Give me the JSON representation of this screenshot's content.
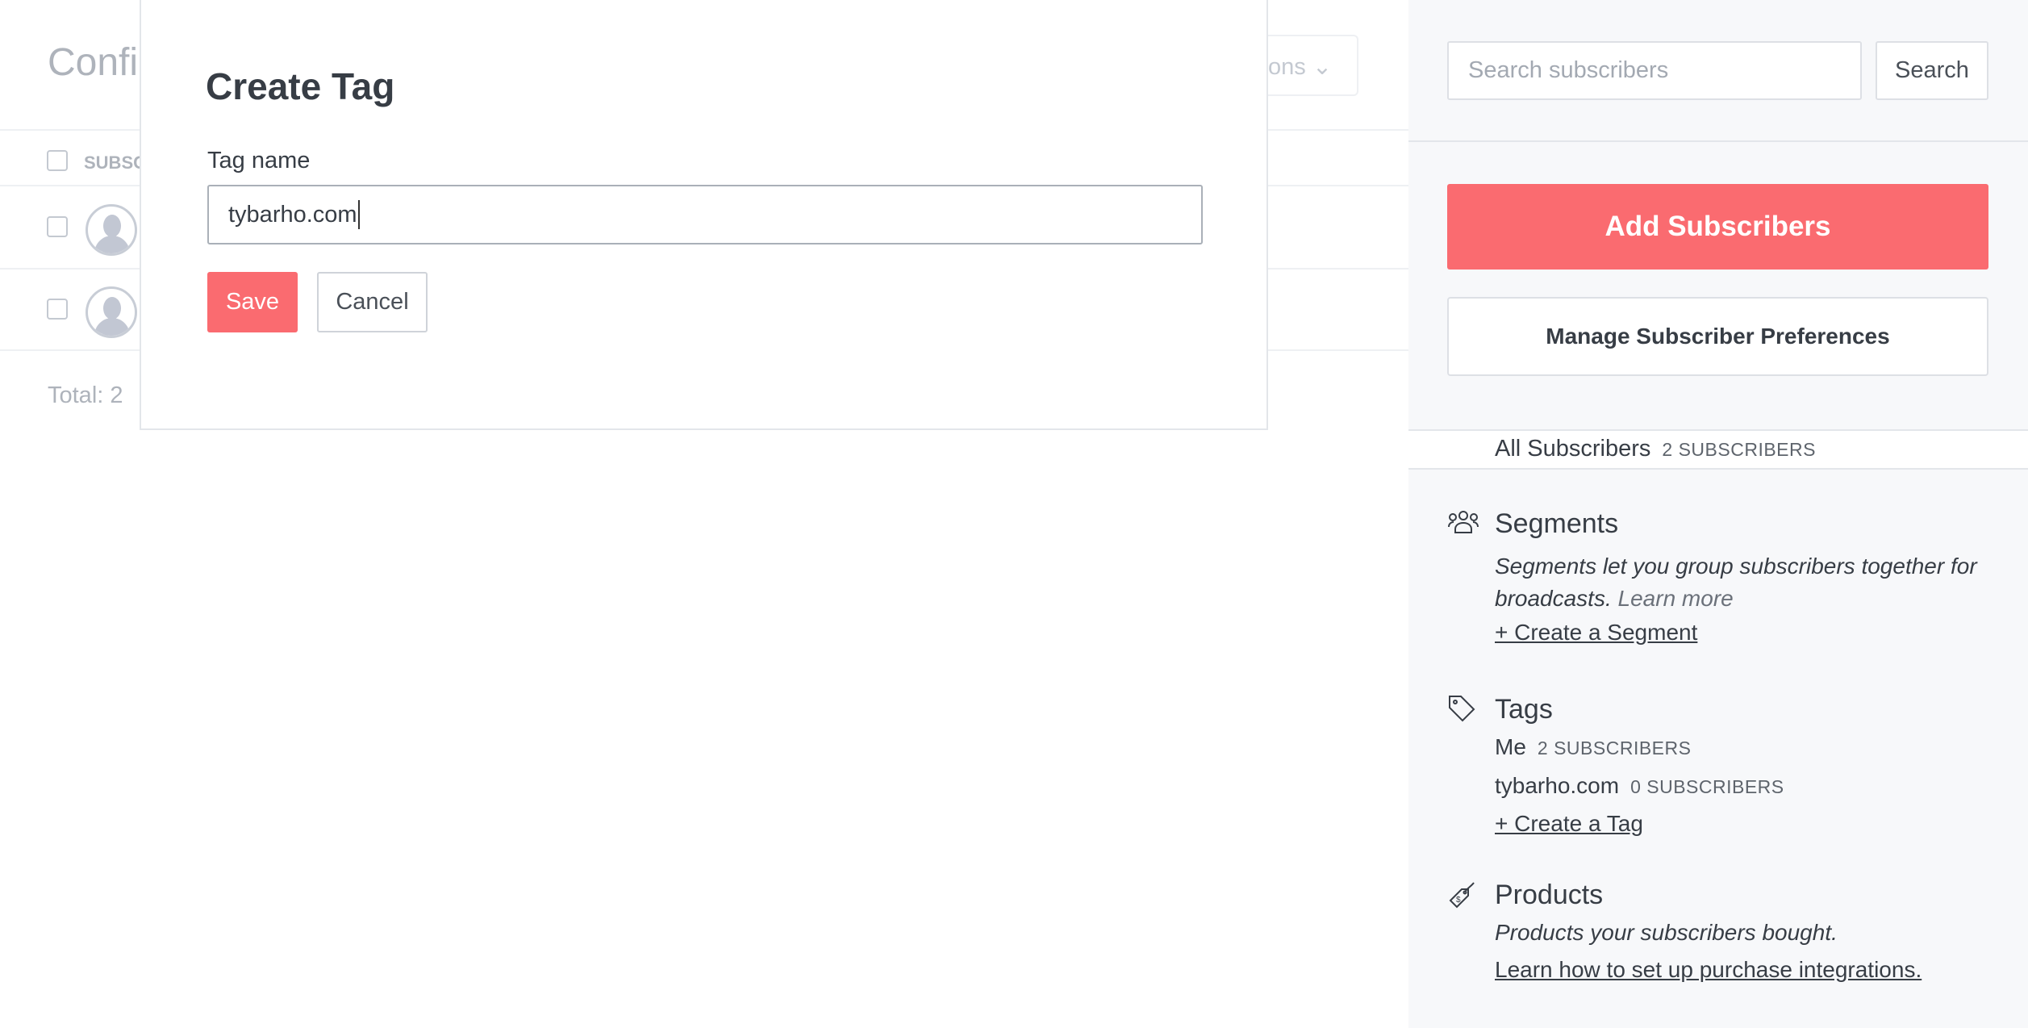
{
  "background_page": {
    "title": "Confi",
    "actions_button": "ons",
    "table_header": "SUBSC",
    "rows": 2,
    "total": "Total: 2"
  },
  "modal": {
    "title": "Create Tag",
    "field_label": "Tag name",
    "field_value": "tybarho.com",
    "save_label": "Save",
    "cancel_label": "Cancel"
  },
  "sidebar": {
    "search_placeholder": "Search subscribers",
    "search_button": "Search",
    "add_button": "Add Subscribers",
    "manage_button": "Manage Subscriber Preferences",
    "all_subscribers": {
      "label": "All Subscribers",
      "count": "2 SUBSCRIBERS"
    },
    "segments": {
      "icon": "users-icon",
      "title": "Segments",
      "description": "Segments let you group subscribers together for broadcasts.",
      "learn_more": "Learn more",
      "create_link": "+ Create a Segment"
    },
    "tags": {
      "icon": "tag-icon",
      "title": "Tags",
      "items": [
        {
          "name": "Me",
          "count": "2 SUBSCRIBERS"
        },
        {
          "name": "tybarho.com",
          "count": "0 SUBSCRIBERS"
        }
      ],
      "create_link": "+ Create a Tag"
    },
    "products": {
      "icon": "price-tag-icon",
      "title": "Products",
      "description": "Products your subscribers bought.",
      "link": "Learn how to set up purchase integrations."
    }
  },
  "colors": {
    "accent": "#fa6b70",
    "sidebar_bg": "#f7f8fa"
  }
}
